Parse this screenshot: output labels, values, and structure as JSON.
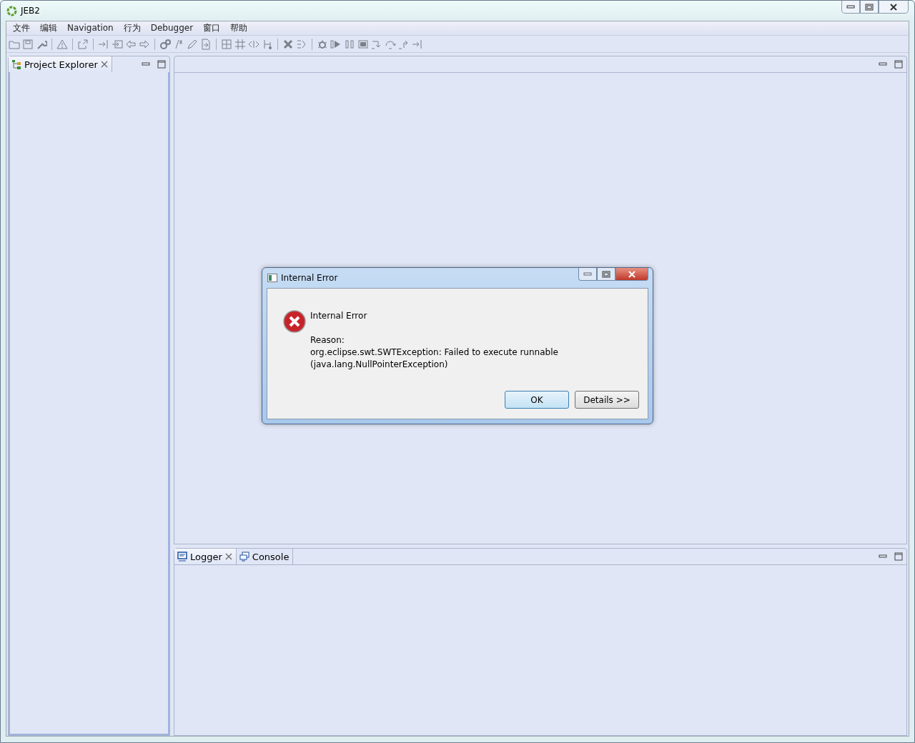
{
  "window": {
    "title": "JEB2"
  },
  "menu": [
    "文件",
    "编辑",
    "Navigation",
    "行为",
    "Debugger",
    "窗口",
    "帮助"
  ],
  "left_panel": {
    "tabs": [
      {
        "label": "Project Explorer",
        "selected": true
      }
    ]
  },
  "bottom_panel": {
    "tabs": [
      {
        "label": "Logger",
        "selected": true
      },
      {
        "label": "Console",
        "selected": false
      }
    ]
  },
  "dialog": {
    "title": "Internal Error",
    "heading": "Internal Error",
    "reason_label": "Reason:",
    "message": "org.eclipse.swt.SWTException: Failed to execute runnable",
    "detail": "(java.lang.NullPointerException)",
    "buttons": [
      {
        "label": "OK",
        "selected": true
      },
      {
        "label": "Details >>",
        "selected": false
      }
    ]
  }
}
